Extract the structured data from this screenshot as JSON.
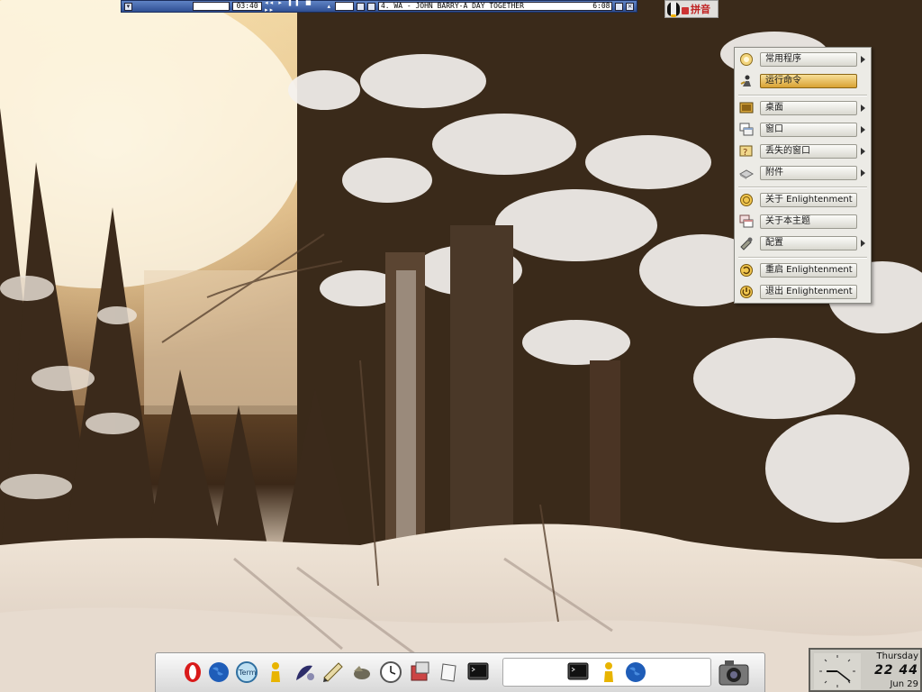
{
  "player": {
    "elapsed": "03:40",
    "track": "4. WA - JOHN BARRY-A DAY TOGETHER",
    "duration": "6:08"
  },
  "tray": {
    "ime_label": "拼音",
    "icons": [
      "penguin-icon",
      "lock-icon"
    ]
  },
  "menu": {
    "items": [
      {
        "label": "常用程序",
        "icon": "favorites-icon",
        "submenu": true
      },
      {
        "label": "运行命令",
        "icon": "run-command-icon",
        "submenu": false,
        "selected": true
      },
      {
        "label": "桌面",
        "icon": "desktop-icon",
        "submenu": true
      },
      {
        "label": "窗口",
        "icon": "windows-icon",
        "submenu": true
      },
      {
        "label": "丢失的窗口",
        "icon": "lost-windows-icon",
        "submenu": true
      },
      {
        "label": "附件",
        "icon": "accessories-icon",
        "submenu": true
      },
      {
        "label": "关于 Enlightenment",
        "icon": "about-e-icon",
        "submenu": false
      },
      {
        "label": "关于本主题",
        "icon": "about-theme-icon",
        "submenu": false
      },
      {
        "label": "配置",
        "icon": "settings-icon",
        "submenu": true
      },
      {
        "label": "重启 Enlightenment",
        "icon": "restart-icon",
        "submenu": false
      },
      {
        "label": "退出 Enlightenment",
        "icon": "exit-icon",
        "submenu": false
      }
    ]
  },
  "dock": {
    "launchers": [
      "opera-icon",
      "browser-globe-icon",
      "terminal-term-icon",
      "user-figure-icon",
      "gimp-paint-icon",
      "editor-icon",
      "gimp-icon",
      "clock-app-icon",
      "package-manager-icon",
      "notes-icon",
      "terminal-icon"
    ],
    "term_label": "Term",
    "tasks": [
      "terminal-icon",
      "user-figure-icon",
      "browser-globe-icon"
    ],
    "camera": "camera-icon"
  },
  "clock": {
    "day": "Thursday",
    "time": "22 44",
    "date": "Jun 29"
  },
  "colors": {
    "menu_highlight": "#d9a233",
    "player_bar": "#2f4f93"
  }
}
